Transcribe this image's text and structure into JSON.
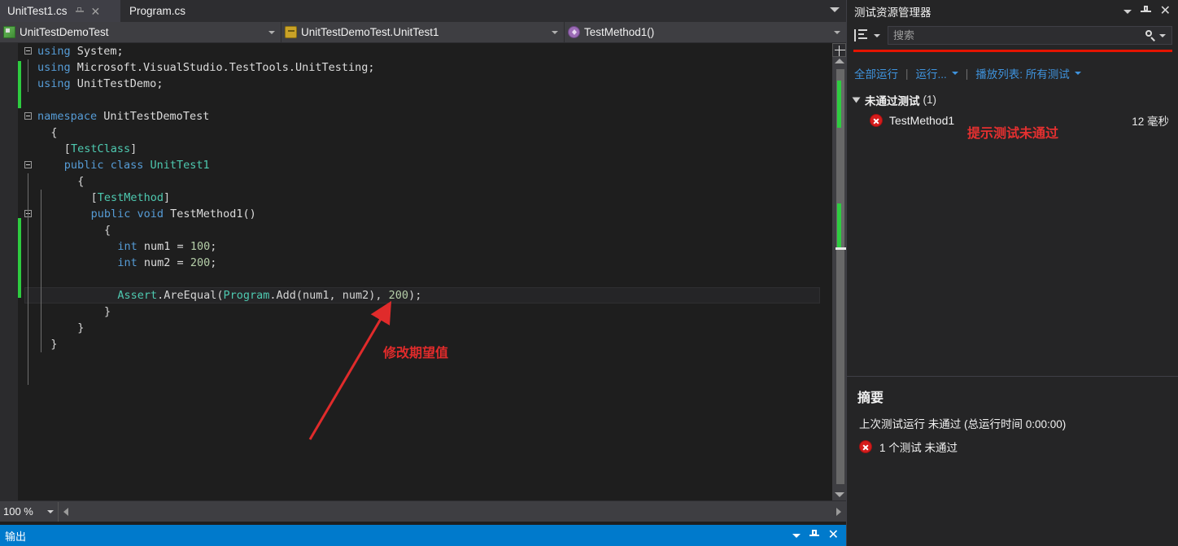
{
  "editor": {
    "tabs": [
      {
        "label": "UnitTest1.cs",
        "active": true
      },
      {
        "label": "Program.cs",
        "active": false
      }
    ],
    "tab_pin_icon": "pin-icon",
    "tab_close_icon": "close-icon",
    "tabstrip_dropdown_icon": "chevron-down-icon",
    "navbar": {
      "project": {
        "label": "UnitTestDemoTest",
        "icon": "class-project-icon"
      },
      "type": {
        "label": "UnitTestDemoTest.UnitTest1",
        "icon": "package-icon"
      },
      "member": {
        "label": "TestMethod1()",
        "icon": "method-icon"
      }
    },
    "zoom_level": "100 %",
    "zoom_caret_icon": "chevron-down-icon",
    "hscroll_left_icon": "arrow-left-icon",
    "hscroll_right_icon": "arrow-right-icon",
    "code_lines": [
      {
        "indent": 0,
        "fold": true,
        "tokens": [
          {
            "t": "using ",
            "c": "kw"
          },
          {
            "t": "System;",
            "c": "id"
          }
        ]
      },
      {
        "indent": 0,
        "fold": false,
        "tokens": [
          {
            "t": "using ",
            "c": "kw"
          },
          {
            "t": "Microsoft.VisualStudio.TestTools.UnitTesting;",
            "c": "id"
          }
        ]
      },
      {
        "indent": 0,
        "fold": false,
        "tokens": [
          {
            "t": "using ",
            "c": "kw"
          },
          {
            "t": "UnitTestDemo;",
            "c": "id"
          }
        ]
      },
      {
        "indent": 0,
        "fold": false,
        "tokens": []
      },
      {
        "indent": 0,
        "fold": true,
        "tokens": [
          {
            "t": "namespace ",
            "c": "kw"
          },
          {
            "t": "UnitTestDemoTest",
            "c": "id"
          }
        ]
      },
      {
        "indent": 1,
        "fold": false,
        "tokens": [
          {
            "t": "{",
            "c": "pl"
          }
        ]
      },
      {
        "indent": 2,
        "fold": false,
        "tokens": [
          {
            "t": "[",
            "c": "pl"
          },
          {
            "t": "TestClass",
            "c": "attr"
          },
          {
            "t": "]",
            "c": "pl"
          }
        ]
      },
      {
        "indent": 2,
        "fold": true,
        "tokens": [
          {
            "t": "public ",
            "c": "kw"
          },
          {
            "t": "class ",
            "c": "kw"
          },
          {
            "t": "UnitTest1",
            "c": "cls"
          }
        ]
      },
      {
        "indent": 3,
        "fold": false,
        "tokens": [
          {
            "t": "{",
            "c": "pl"
          }
        ]
      },
      {
        "indent": 4,
        "fold": false,
        "tokens": [
          {
            "t": "[",
            "c": "pl"
          },
          {
            "t": "TestMethod",
            "c": "attr"
          },
          {
            "t": "]",
            "c": "pl"
          }
        ]
      },
      {
        "indent": 4,
        "fold": true,
        "tokens": [
          {
            "t": "public ",
            "c": "kw"
          },
          {
            "t": "void ",
            "c": "kw"
          },
          {
            "t": "TestMethod1()",
            "c": "id"
          }
        ]
      },
      {
        "indent": 5,
        "fold": false,
        "tokens": [
          {
            "t": "{",
            "c": "pl"
          }
        ]
      },
      {
        "indent": 6,
        "fold": false,
        "tokens": [
          {
            "t": "int ",
            "c": "kw"
          },
          {
            "t": "num1 = ",
            "c": "id"
          },
          {
            "t": "100",
            "c": "num"
          },
          {
            "t": ";",
            "c": "pl"
          }
        ]
      },
      {
        "indent": 6,
        "fold": false,
        "tokens": [
          {
            "t": "int ",
            "c": "kw"
          },
          {
            "t": "num2 = ",
            "c": "id"
          },
          {
            "t": "200",
            "c": "num"
          },
          {
            "t": ";",
            "c": "pl"
          }
        ]
      },
      {
        "indent": 0,
        "fold": false,
        "tokens": []
      },
      {
        "indent": 6,
        "fold": false,
        "current": true,
        "tokens": [
          {
            "t": "Assert",
            "c": "ty"
          },
          {
            "t": ".AreEqual(",
            "c": "pl"
          },
          {
            "t": "Program",
            "c": "ty"
          },
          {
            "t": ".Add(num1, num2), ",
            "c": "pl"
          },
          {
            "t": "200",
            "c": "num"
          },
          {
            "t": ");",
            "c": "pl"
          }
        ]
      },
      {
        "indent": 5,
        "fold": false,
        "tokens": [
          {
            "t": "}",
            "c": "pl"
          }
        ]
      },
      {
        "indent": 3,
        "fold": false,
        "tokens": [
          {
            "t": "}",
            "c": "pl"
          }
        ]
      },
      {
        "indent": 1,
        "fold": false,
        "tokens": [
          {
            "t": "}",
            "c": "pl"
          }
        ]
      }
    ],
    "annotation": {
      "text": "修改期望值",
      "color": "#e02b2b",
      "arrow": "red-arrow"
    },
    "output_bar": {
      "label": "输出",
      "caret_icon": "chevron-down-icon",
      "pin_icon": "pin-icon",
      "close_icon": "close-icon"
    }
  },
  "test_explorer": {
    "title": "测试资源管理器",
    "title_caret_icon": "chevron-down-icon",
    "title_pin_icon": "pin-icon",
    "title_close_icon": "close-icon",
    "group_by_icon": "group-by-icon",
    "group_by_caret_icon": "chevron-down-icon",
    "search": {
      "value": "",
      "placeholder": "搜索",
      "icon": "search-icon",
      "caret_icon": "chevron-down-icon"
    },
    "progress_bar_color": "#e51400",
    "actions": {
      "run_all": "全部运行",
      "run": "运行...",
      "playlist": "播放列表: 所有测试",
      "separator": "|"
    },
    "group": {
      "name": "未通过测试",
      "count": "(1)",
      "expand_icon": "triangle-down-icon"
    },
    "tests": [
      {
        "name": "TestMethod1",
        "duration": "12 毫秒",
        "status_icon": "fail-icon"
      }
    ],
    "annotation": {
      "text": "提示测试未通过",
      "color": "#e53030"
    },
    "summary": {
      "title": "摘要",
      "last_run": "上次测试运行 未通过 (总运行时间 0:00:00)",
      "failed_count": "1 个测试 未通过",
      "failed_icon": "fail-icon"
    }
  }
}
